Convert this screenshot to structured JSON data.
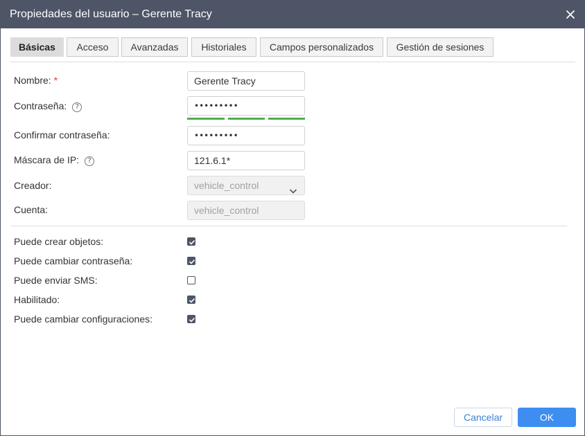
{
  "dialog": {
    "title": "Propiedades del usuario – Gerente Tracy"
  },
  "tabs": [
    {
      "label": "Básicas",
      "active": true
    },
    {
      "label": "Acceso",
      "active": false
    },
    {
      "label": "Avanzadas",
      "active": false
    },
    {
      "label": "Historiales",
      "active": false
    },
    {
      "label": "Campos personalizados",
      "active": false
    },
    {
      "label": "Gestión de sesiones",
      "active": false
    }
  ],
  "form": {
    "name_label": "Nombre:",
    "name_required_mark": "*",
    "name_value": "Gerente Tracy",
    "password_label": "Contraseña:",
    "password_value": "•••••••••",
    "confirm_label": "Confirmar contraseña:",
    "confirm_value": "•••••••••",
    "ipmask_label": "Máscara de IP:",
    "ipmask_value": "121.6.1*",
    "creator_label": "Creador:",
    "creator_value": "vehicle_control",
    "account_label": "Cuenta:",
    "account_value": "vehicle_control",
    "help_glyph": "?"
  },
  "permissions": [
    {
      "label": "Puede crear objetos:",
      "checked": true
    },
    {
      "label": "Puede cambiar contraseña:",
      "checked": true
    },
    {
      "label": "Puede enviar SMS:",
      "checked": false
    },
    {
      "label": "Habilitado:",
      "checked": true
    },
    {
      "label": "Puede cambiar configuraciones:",
      "checked": true
    }
  ],
  "buttons": {
    "cancel": "Cancelar",
    "ok": "OK"
  },
  "colors": {
    "titlebar": "#4d5566",
    "accent": "#3d8ef0",
    "strength": "#4caf50",
    "required": "#e53935"
  },
  "icons": {
    "close": "close-icon",
    "help": "help-circle-icon",
    "dropdown": "chevron-down-icon",
    "check": "check-icon"
  }
}
